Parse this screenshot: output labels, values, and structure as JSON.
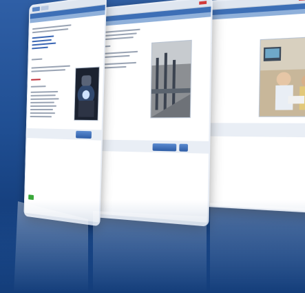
{
  "scene": {
    "background_top": "#2f5fa6",
    "background_bottom": "#16407f",
    "accent": "#3d6fb6"
  },
  "panels": [
    {
      "id": "back",
      "image": "hospital-monitor-photo"
    },
    {
      "id": "middle",
      "image": "factory-line-photo"
    },
    {
      "id": "front",
      "image": "welder-sparks-photo"
    }
  ]
}
